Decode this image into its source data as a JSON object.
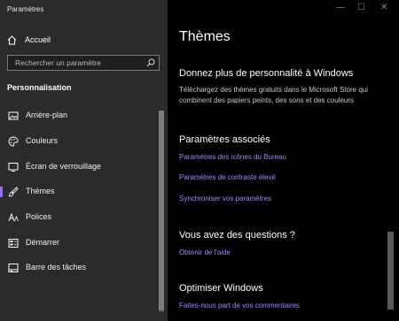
{
  "window": {
    "title": "Paramètres",
    "controls": {
      "minimize": "—",
      "maximize": "☐",
      "close": "✕"
    }
  },
  "sidebar": {
    "home_label": "Accueil",
    "search_placeholder": "Rechercher un paramètre",
    "section_title": "Personnalisation",
    "items": [
      {
        "label": "Arrière-plan",
        "icon": "image-icon"
      },
      {
        "label": "Couleurs",
        "icon": "palette-icon"
      },
      {
        "label": "Écran de verrouillage",
        "icon": "lock-screen-icon"
      },
      {
        "label": "Thèmes",
        "icon": "brush-icon",
        "active": true
      },
      {
        "label": "Polices",
        "icon": "font-icon"
      },
      {
        "label": "Démarrer",
        "icon": "start-icon"
      },
      {
        "label": "Barre des tâches",
        "icon": "taskbar-icon"
      }
    ]
  },
  "main": {
    "page_title": "Thèmes",
    "promo": {
      "heading": "Donnez plus de personnalité à Windows",
      "line1": "Téléchargez des thèmes gratuits dans le Microsoft Store qui",
      "line2": "combinent des papiers peints, des sons et des couleurs"
    },
    "related": {
      "heading": "Paramètres associés",
      "links": [
        "Paramètres des icônes du Bureau",
        "Paramètres de contraste élevé",
        "Synchroniser vos paramètres"
      ]
    },
    "questions": {
      "heading": "Vous avez des questions ?",
      "link": "Obtenir de l'aide"
    },
    "improve": {
      "heading": "Optimiser Windows",
      "link": "Faites-nous part de vos commentaires"
    }
  },
  "colors": {
    "accent": "#9b6cff",
    "link": "#9d8cff",
    "sidebar_bg": "#2b2b2b",
    "main_bg": "#000000"
  }
}
